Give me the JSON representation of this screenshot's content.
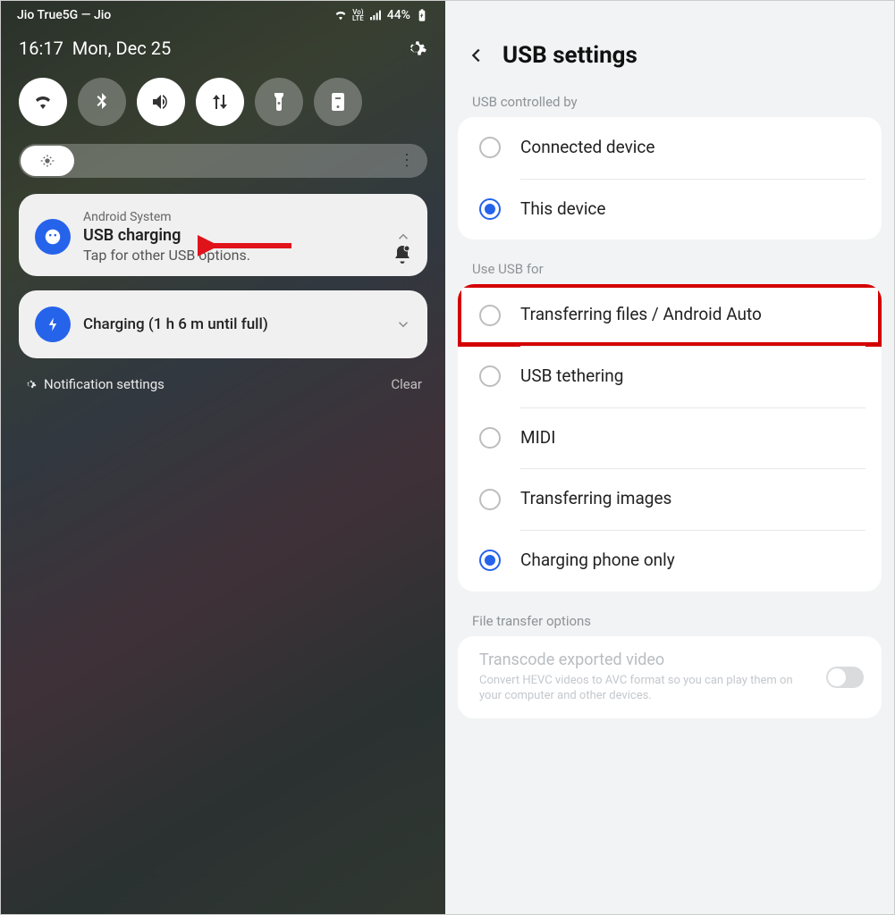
{
  "left": {
    "status": {
      "carrier": "Jio True5G — Jio",
      "battery": "44%"
    },
    "time": "16:17",
    "date": "Mon, Dec 25",
    "notif1": {
      "app": "Android System",
      "title": "USB charging",
      "subtitle": "Tap for other USB options."
    },
    "notif2": {
      "title": "Charging (1 h 6 m until full)"
    },
    "bottom": {
      "settings": "Notification settings",
      "clear": "Clear"
    }
  },
  "right": {
    "title": "USB settings",
    "section1": {
      "label": "USB controlled by",
      "options": [
        {
          "label": "Connected device",
          "selected": false
        },
        {
          "label": "This device",
          "selected": true
        }
      ]
    },
    "section2": {
      "label": "Use USB for",
      "options": [
        {
          "label": "Transferring files / Android Auto",
          "selected": false,
          "highlighted": true
        },
        {
          "label": "USB tethering",
          "selected": false
        },
        {
          "label": "MIDI",
          "selected": false
        },
        {
          "label": "Transferring images",
          "selected": false
        },
        {
          "label": "Charging phone only",
          "selected": true
        }
      ]
    },
    "section3": {
      "label": "File transfer options",
      "title": "Transcode exported video",
      "subtitle": "Convert HEVC videos to AVC format so you can play them on your computer and other devices."
    }
  }
}
